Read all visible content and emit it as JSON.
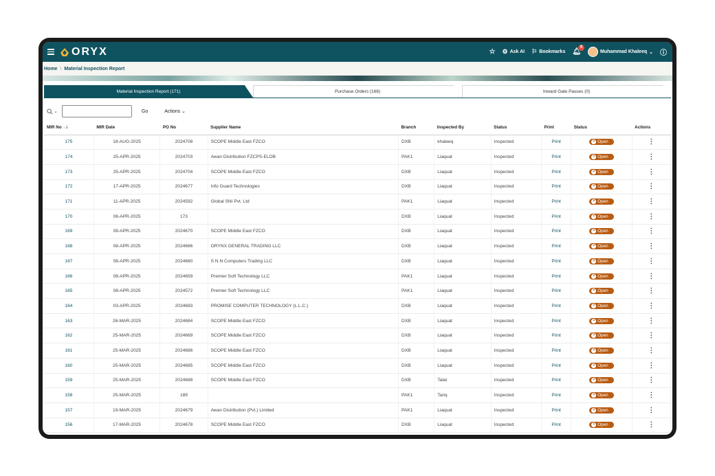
{
  "app": {
    "name": "ORYX"
  },
  "topbar": {
    "ask_ai": "Ask AI",
    "bookmarks": "Bookmarks",
    "notifications_count": "9",
    "user_name": "Muhammad Khaleeq"
  },
  "breadcrumb": {
    "home": "Home",
    "current": "Material Inspection Report"
  },
  "tabs": [
    {
      "label": "Material Inspection Report (171)",
      "active": true
    },
    {
      "label": "Purchase Orders (168)",
      "active": false
    },
    {
      "label": "Inward Gate Passes (0)",
      "active": false
    }
  ],
  "toolbar": {
    "search_value": "",
    "go_label": "Go",
    "actions_label": "Actions"
  },
  "table": {
    "headers": [
      "MIR No",
      "MIR Date",
      "PO No",
      "Supplier Name",
      "Branch",
      "Inspected By",
      "Status",
      "Print",
      "Status",
      "Actions"
    ],
    "print_label": "Print",
    "open_label": "Open",
    "rows": [
      [
        "175",
        "18-AUG-2025",
        "2024708",
        "SCOPE Middle East FZCO",
        "DXB",
        "khaleeq",
        "Inspected"
      ],
      [
        "174",
        "25-APR-2025",
        "2024703",
        "Awan Distribution FZCPS-ELOB",
        "PAK1",
        "Liaquat",
        "Inspected"
      ],
      [
        "173",
        "25-APR-2025",
        "2024704",
        "SCOPE Middle East FZCO",
        "DXB",
        "Liaquat",
        "Inspected"
      ],
      [
        "172",
        "17-APR-2025",
        "2024677",
        "Info Guard Technologies",
        "DXB",
        "Liaquat",
        "Inspected"
      ],
      [
        "171",
        "11-APR-2025",
        "2024592",
        "Global SNI Pvt. Ltd",
        "PAK1",
        "Liaquat",
        "Inspected"
      ],
      [
        "170",
        "08-APR-2025",
        "173",
        "",
        "DXB",
        "Liaquat",
        "Inspected"
      ],
      [
        "169",
        "08-APR-2025",
        "2024670",
        "SCOPE Middle East FZCO",
        "DXB",
        "Liaquat",
        "Inspected"
      ],
      [
        "168",
        "08-APR-2025",
        "2024666",
        "ORYNX GENERAL TRADING LLC",
        "DXB",
        "Liaquat",
        "Inspected"
      ],
      [
        "167",
        "08-APR-2025",
        "2024660",
        "S N N Computers Trading LLC",
        "DXB",
        "Liaquat",
        "Inspected"
      ],
      [
        "166",
        "08-APR-2025",
        "2024659",
        "Premier Soft Technology LLC",
        "PAK1",
        "Liaquat",
        "Inspected"
      ],
      [
        "165",
        "08-APR-2025",
        "2024572",
        "Premier Soft Technology LLC",
        "PAK1",
        "Liaquat",
        "Inspected"
      ],
      [
        "164",
        "03-APR-2025",
        "2024683",
        "PROMISE COMPUTER TECHNOLOGY (L.L.C.)",
        "DXB",
        "Liaquat",
        "Inspected"
      ],
      [
        "163",
        "26-MAR-2025",
        "2024684",
        "SCOPE Middle East FZCO",
        "DXB",
        "Liaquat",
        "Inspected"
      ],
      [
        "162",
        "25-MAR-2025",
        "2024669",
        "SCOPE Middle East FZCO",
        "DXB",
        "Liaquat",
        "Inspected"
      ],
      [
        "161",
        "25-MAR-2025",
        "2024686",
        "SCOPE Middle East FZCO",
        "DXB",
        "Liaquat",
        "Inspected"
      ],
      [
        "160",
        "25-MAR-2025",
        "2024685",
        "SCOPE Middle East FZCO",
        "DXB",
        "Liaquat",
        "Inspected"
      ],
      [
        "159",
        "25-MAR-2025",
        "2024688",
        "SCOPE Middle East FZCO",
        "DXB",
        "Talat",
        "Inspected"
      ],
      [
        "158",
        "25-MAR-2025",
        "189",
        "",
        "PAK1",
        "Tariq",
        "Inspected"
      ],
      [
        "157",
        "19-MAR-2025",
        "2024679",
        "Awan Distribution (Pvt.) Limited",
        "PAK1",
        "Liaquat",
        "Inspected"
      ],
      [
        "156",
        "17-MAR-2025",
        "2024678",
        "SCOPE Middle East FZCO",
        "DXB",
        "Liaquat",
        "Inspected"
      ]
    ]
  },
  "colors": {
    "brand": "#0f5360",
    "status_open": "#b85c14"
  }
}
